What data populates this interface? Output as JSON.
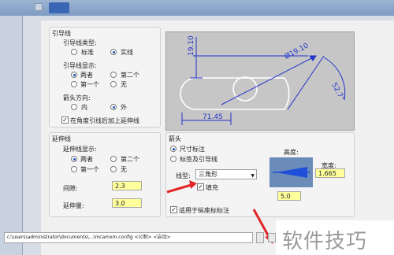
{
  "leader_panel": {
    "title": "引导线",
    "type_label": "引导线类型:",
    "type_options": [
      "标准",
      "实线"
    ],
    "display_label": "引导线显示:",
    "display_options": [
      "两者",
      "第二个",
      "第一个",
      "无"
    ],
    "arrow_dir_label": "箭头方向:",
    "arrow_dir_options": [
      "内",
      "外"
    ],
    "extension_checkbox": "在角度引线后加上延伸线"
  },
  "preview": {
    "dim_vertical": "19.10",
    "dim_diameter": "Ø19.10",
    "dim_angle": "52.7°",
    "dim_horizontal": "71.45"
  },
  "extension_panel": {
    "title": "延伸线",
    "display_label": "延伸线显示:",
    "display_options": [
      "两者",
      "第二个",
      "第一个",
      "无"
    ],
    "gap_label": "间隙:",
    "gap_value": "2.3",
    "extend_label": "延伸量:",
    "extend_value": "3.0"
  },
  "arrow_panel": {
    "title": "箭头",
    "options": [
      "尺寸标注",
      "标签及引导线"
    ],
    "linetype_label": "线型:",
    "linetype_value": "三角形",
    "fill_label": "填充",
    "height_label": "高度:",
    "width_label": "宽度:",
    "width_value": "1.665",
    "height_value": "5.0",
    "ordinate_checkbox": "适用于纵座标标注"
  },
  "statusbar": {
    "path": "c:\\users\\administrator\\documents\\...\\mcamxm.config <公制> <启动>"
  },
  "watermark": "软件技巧",
  "colors": {
    "accent": "#1a55b8",
    "field": "#ffff9c",
    "arrow_red": "#e32626"
  }
}
